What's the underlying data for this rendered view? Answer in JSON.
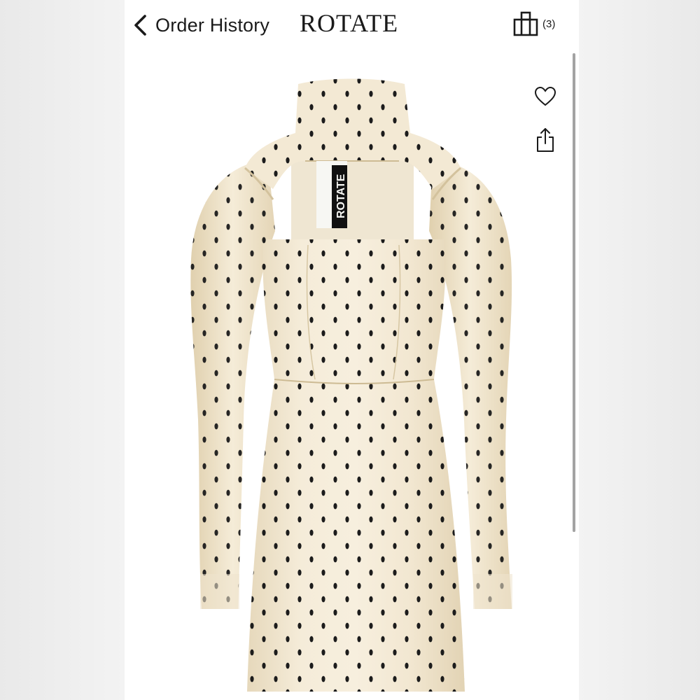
{
  "header": {
    "back_label": "Order History",
    "brand_name": "ROTATE",
    "bag_count": "(3)"
  },
  "icons": {
    "back": "chevron-left-icon",
    "bag": "shopping-bag-icon",
    "heart": "heart-icon",
    "share": "share-icon"
  },
  "product": {
    "image_description": "cream polka dot mini dress with puff sleeves and high neck",
    "tag_text": "ROTATE",
    "colors": {
      "fabric": "#f3e8d3",
      "dots": "#1c1c1c",
      "shadow": "#d8caa8"
    }
  },
  "colors": {
    "text": "#1a1a1a",
    "background": "#ffffff",
    "scrollbar": "#8c8c8c"
  }
}
